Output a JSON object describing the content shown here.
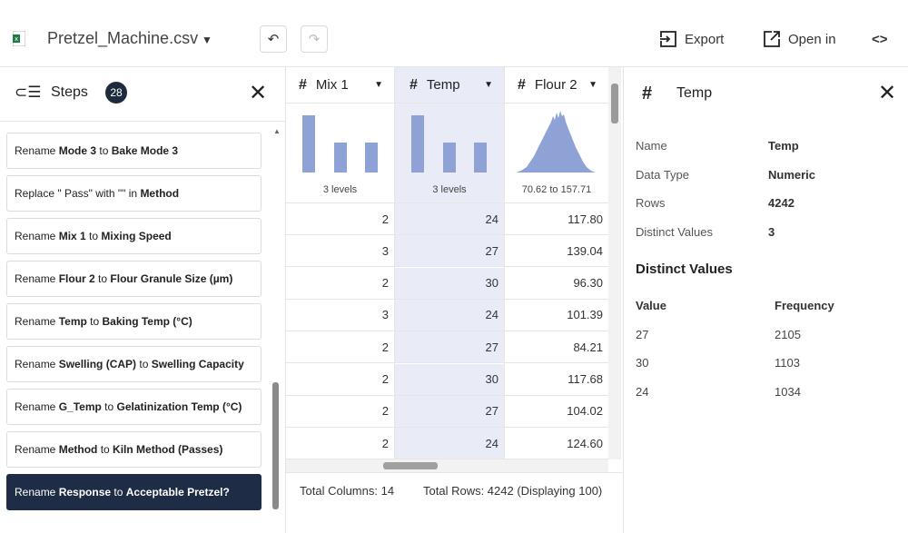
{
  "header": {
    "file_name": "Pretzel_Machine.csv",
    "undo_icon": "undo-icon",
    "redo_icon": "redo-icon",
    "export_label": "Export",
    "open_in_label": "Open in",
    "code_label": "<>"
  },
  "steps_panel": {
    "title": "Steps",
    "count": "28",
    "items": [
      {
        "pre": "Rename ",
        "a": "Mode 3",
        "mid": " to ",
        "b": "Bake Mode 3"
      },
      {
        "pre": "Replace \" Pass\" with \"\" in ",
        "a": "Method",
        "mid": "",
        "b": ""
      },
      {
        "pre": "Rename ",
        "a": "Mix 1",
        "mid": " to ",
        "b": "Mixing Speed"
      },
      {
        "pre": "Rename ",
        "a": "Flour 2",
        "mid": " to ",
        "b": "Flour Granule Size (µm)"
      },
      {
        "pre": "Rename ",
        "a": "Temp",
        "mid": " to ",
        "b": "Baking Temp (°C)"
      },
      {
        "pre": "Rename ",
        "a": "Swelling (CAP)",
        "mid": " to ",
        "b": "Swelling Capacity"
      },
      {
        "pre": "Rename ",
        "a": "G_Temp",
        "mid": " to ",
        "b": "Gelatinization Temp (°C)"
      },
      {
        "pre": "Rename ",
        "a": "Method",
        "mid": " to ",
        "b": "Kiln Method (Passes)"
      },
      {
        "pre": "Rename ",
        "a": "Response",
        "mid": " to ",
        "b": "Acceptable Pretzel?"
      }
    ]
  },
  "grid": {
    "columns": [
      {
        "name": "Mix 1",
        "summary": "3 levels",
        "bars": [
          0.95,
          0.5,
          0.5
        ]
      },
      {
        "name": "Temp",
        "summary": "3 levels",
        "bars": [
          0.95,
          0.5,
          0.5
        ]
      },
      {
        "name": "Flour 2",
        "summary": "70.62 to 157.71"
      }
    ],
    "rows": [
      [
        "2",
        "24",
        "117.80"
      ],
      [
        "3",
        "27",
        "139.04"
      ],
      [
        "2",
        "30",
        "96.30"
      ],
      [
        "3",
        "24",
        "101.39"
      ],
      [
        "2",
        "27",
        "84.21"
      ],
      [
        "2",
        "30",
        "117.68"
      ],
      [
        "2",
        "27",
        "104.02"
      ],
      [
        "2",
        "24",
        "124.60"
      ]
    ],
    "footer_columns": "Total Columns: 14",
    "footer_rows": "Total Rows: 4242 (Displaying 100)"
  },
  "details": {
    "title": "Temp",
    "props": [
      {
        "label": "Name",
        "value": "Temp"
      },
      {
        "label": "Data Type",
        "value": "Numeric"
      },
      {
        "label": "Rows",
        "value": "4242"
      },
      {
        "label": "Distinct Values",
        "value": "3"
      }
    ],
    "distinct_title": "Distinct Values",
    "value_header": "Value",
    "freq_header": "Frequency",
    "distinct": [
      {
        "value": "27",
        "freq": "2105"
      },
      {
        "value": "30",
        "freq": "1103"
      },
      {
        "value": "24",
        "freq": "1034"
      }
    ]
  },
  "colors": {
    "accent_dark": "#1e2d45",
    "bar": "#8ea2d6",
    "selected_col": "#e9ecf7"
  }
}
